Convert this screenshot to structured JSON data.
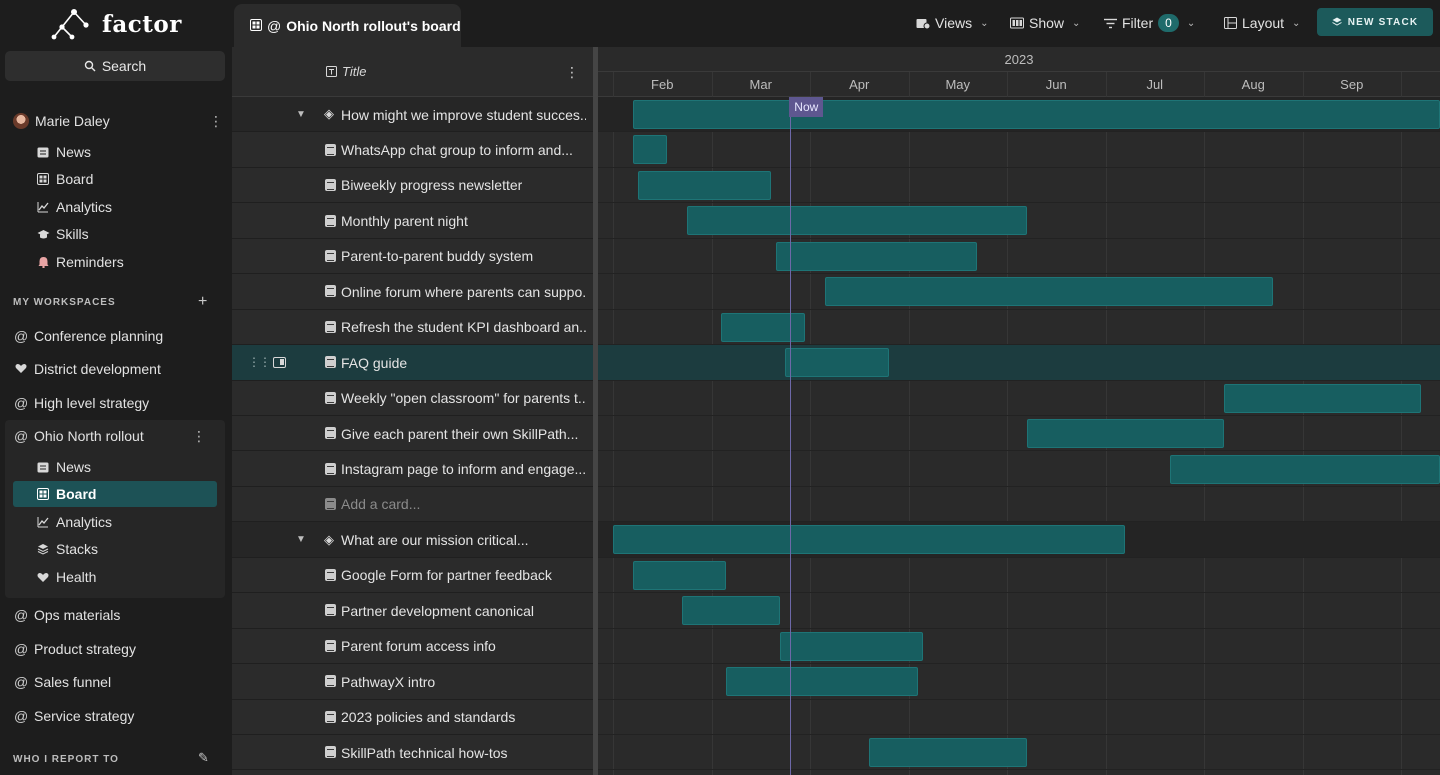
{
  "app": {
    "name": "factor"
  },
  "sidebar": {
    "search_label": "Search",
    "user": {
      "name": "Marie Daley"
    },
    "user_items": [
      {
        "label": "News",
        "icon": "news-icon"
      },
      {
        "label": "Board",
        "icon": "board-icon"
      },
      {
        "label": "Analytics",
        "icon": "analytics-icon"
      },
      {
        "label": "Skills",
        "icon": "skills-icon"
      },
      {
        "label": "Reminders",
        "icon": "bell-icon"
      }
    ],
    "workspaces_label": "MY WORKSPACES",
    "workspaces": [
      {
        "label": "Conference planning",
        "icon": "at-icon"
      },
      {
        "label": "District development",
        "icon": "heart-icon"
      },
      {
        "label": "High level strategy",
        "icon": "at-icon"
      },
      {
        "label": "Ohio North rollout",
        "icon": "at-icon"
      },
      {
        "label": "Ops materials",
        "icon": "at-icon"
      },
      {
        "label": "Product strategy",
        "icon": "at-icon"
      },
      {
        "label": "Sales funnel",
        "icon": "at-icon"
      },
      {
        "label": "Service strategy",
        "icon": "at-icon"
      }
    ],
    "active_workspace_items": [
      {
        "label": "News",
        "icon": "news-icon"
      },
      {
        "label": "Board",
        "icon": "board-icon"
      },
      {
        "label": "Analytics",
        "icon": "analytics-icon"
      },
      {
        "label": "Stacks",
        "icon": "stacks-icon"
      },
      {
        "label": "Health",
        "icon": "heart-icon"
      }
    ],
    "who_label": "WHO I REPORT TO"
  },
  "topbar": {
    "board_title": "Ohio North rollout's board",
    "views_label": "Views",
    "show_label": "Show",
    "filter_label": "Filter",
    "filter_count": "0",
    "layout_label": "Layout",
    "new_stack_label": "NEW STACK"
  },
  "board": {
    "title_header": "Title",
    "add_card_label": "Add a card...",
    "rows": [
      {
        "type": "group",
        "label": "How might we improve student succes...",
        "bar": [
          0.2,
          8.5
        ]
      },
      {
        "type": "card",
        "label": "WhatsApp chat group to inform and...",
        "bar": [
          0.2,
          0.55
        ]
      },
      {
        "type": "card",
        "label": "Biweekly progress newsletter",
        "bar": [
          0.25,
          1.6
        ]
      },
      {
        "type": "card",
        "label": "Monthly parent night",
        "bar": [
          0.75,
          4.2
        ]
      },
      {
        "type": "card",
        "label": "Parent-to-parent buddy system",
        "bar": [
          1.65,
          3.7
        ]
      },
      {
        "type": "card",
        "label": "Online forum where parents can suppo...",
        "bar": [
          2.15,
          6.7
        ]
      },
      {
        "type": "card",
        "label": "Refresh the student KPI dashboard an...",
        "bar": [
          1.1,
          1.95
        ]
      },
      {
        "type": "card",
        "label": "FAQ guide",
        "bar": [
          1.75,
          2.8
        ],
        "selected": true
      },
      {
        "type": "card",
        "label": "Weekly \"open classroom\" for parents t...",
        "bar": [
          6.2,
          8.2
        ]
      },
      {
        "type": "card",
        "label": "Give each parent their own SkillPath...",
        "bar": [
          4.2,
          6.2
        ]
      },
      {
        "type": "card",
        "label": "Instagram page to inform and engage...",
        "bar": [
          5.65,
          8.5
        ]
      },
      {
        "type": "add",
        "label": ""
      },
      {
        "type": "group",
        "label": "What are our mission critical...",
        "bar": [
          0.0,
          5.2
        ]
      },
      {
        "type": "card",
        "label": "Google Form for partner feedback",
        "bar": [
          0.2,
          1.15
        ]
      },
      {
        "type": "card",
        "label": "Partner development canonical",
        "bar": [
          0.7,
          1.7
        ]
      },
      {
        "type": "card",
        "label": "Parent forum access info",
        "bar": [
          1.7,
          3.15
        ]
      },
      {
        "type": "card",
        "label": "PathwayX intro",
        "bar": [
          1.15,
          3.1
        ]
      },
      {
        "type": "card",
        "label": "2023 policies and standards",
        "bar": null
      },
      {
        "type": "card",
        "label": "SkillPath technical how-tos",
        "bar": [
          2.6,
          4.2
        ]
      }
    ]
  },
  "timeline": {
    "year": "2023",
    "months": [
      "Feb",
      "Mar",
      "Apr",
      "May",
      "Jun",
      "Jul",
      "Aug",
      "Sep"
    ],
    "now_label": "Now",
    "now_position": 1.8
  },
  "colors": {
    "accent": "#1d5256",
    "bar": "#175e60",
    "now": "#5e5790"
  }
}
